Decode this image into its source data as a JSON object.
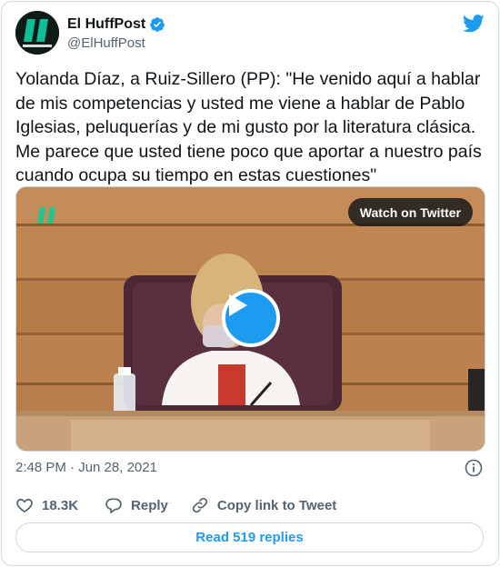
{
  "author": {
    "name": "El HuffPost",
    "handle": "@ElHuffPost",
    "avatar_icon": "huffpost-logo-icon",
    "verified_icon": "verified-badge-icon"
  },
  "platform_icon": "twitter-bird-icon",
  "tweet": {
    "text": "Yolanda Díaz, a Ruiz-Sillero (PP): \"He venido aquí a hablar de mis competencias y usted me viene a hablar de Pablo Iglesias, peluquerías y de mi gusto por la literatura clásica. Me parece que usted tiene poco que aportar a nuestro país cuando ocupa su tiempo en estas cuestiones\""
  },
  "media": {
    "watch_label": "Watch on Twitter",
    "play_icon": "play-icon"
  },
  "meta": {
    "timestamp": "2:48 PM · Jun 28, 2021",
    "info_icon": "info-icon"
  },
  "actions": {
    "like_count": "18.3K",
    "reply_label": "Reply",
    "copy_label": "Copy link to Tweet"
  },
  "read_replies_label": "Read 519 replies",
  "colors": {
    "accent": "#1d9bf0",
    "text": "#0f1419",
    "muted": "#536471",
    "border": "#cfd9de"
  }
}
